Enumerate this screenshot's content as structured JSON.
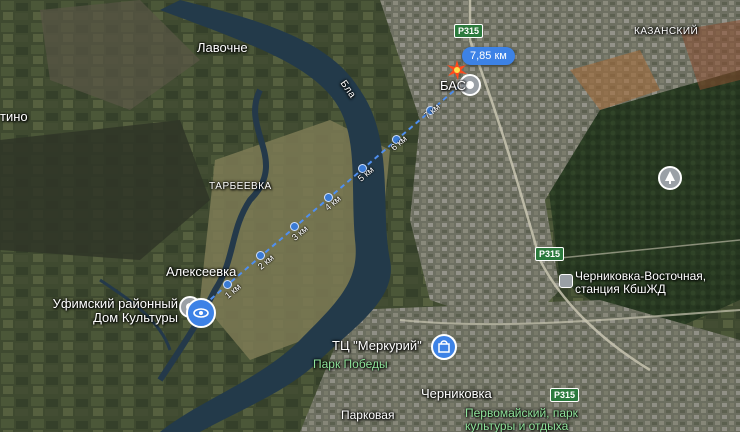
{
  "map": {
    "places": {
      "lavochne": "Лавочне",
      "tino": "тино",
      "tarbeevka": "ТАРБЕЕВКА",
      "alekseevka": "Алексеевка",
      "kazansky": "КАЗАНСКИЙ",
      "chernikovka": "Черниковка",
      "parkovaya": "Парковая",
      "bas": "БАС"
    },
    "river": "Бла",
    "roads": [
      "P315",
      "P315",
      "P315"
    ],
    "pois": {
      "dom_kultury_line1": "Уфимский районный",
      "dom_kultury_line2": "Дом Культуры",
      "merkury": "ТЦ \"Меркурий\"",
      "park_pobedy": "Парк Победы",
      "chernikovka_station_line1": "Черниковка-Восточная,",
      "chernikovka_station_line2": "станция КбшЖД",
      "pervomaysky_line1": "Первомайский, парк",
      "pervomaysky_line2": "культуры и отдыха"
    },
    "measure": {
      "total": "7,85 км",
      "km_labels": [
        "1 км",
        "2 км",
        "3 км",
        "4 км",
        "5 км",
        "6 км",
        "7 км"
      ]
    },
    "icons": [
      "eye-icon",
      "pin-icon",
      "shopping-bag-icon",
      "train-icon",
      "tree-icon",
      "explosion-icon"
    ]
  }
}
